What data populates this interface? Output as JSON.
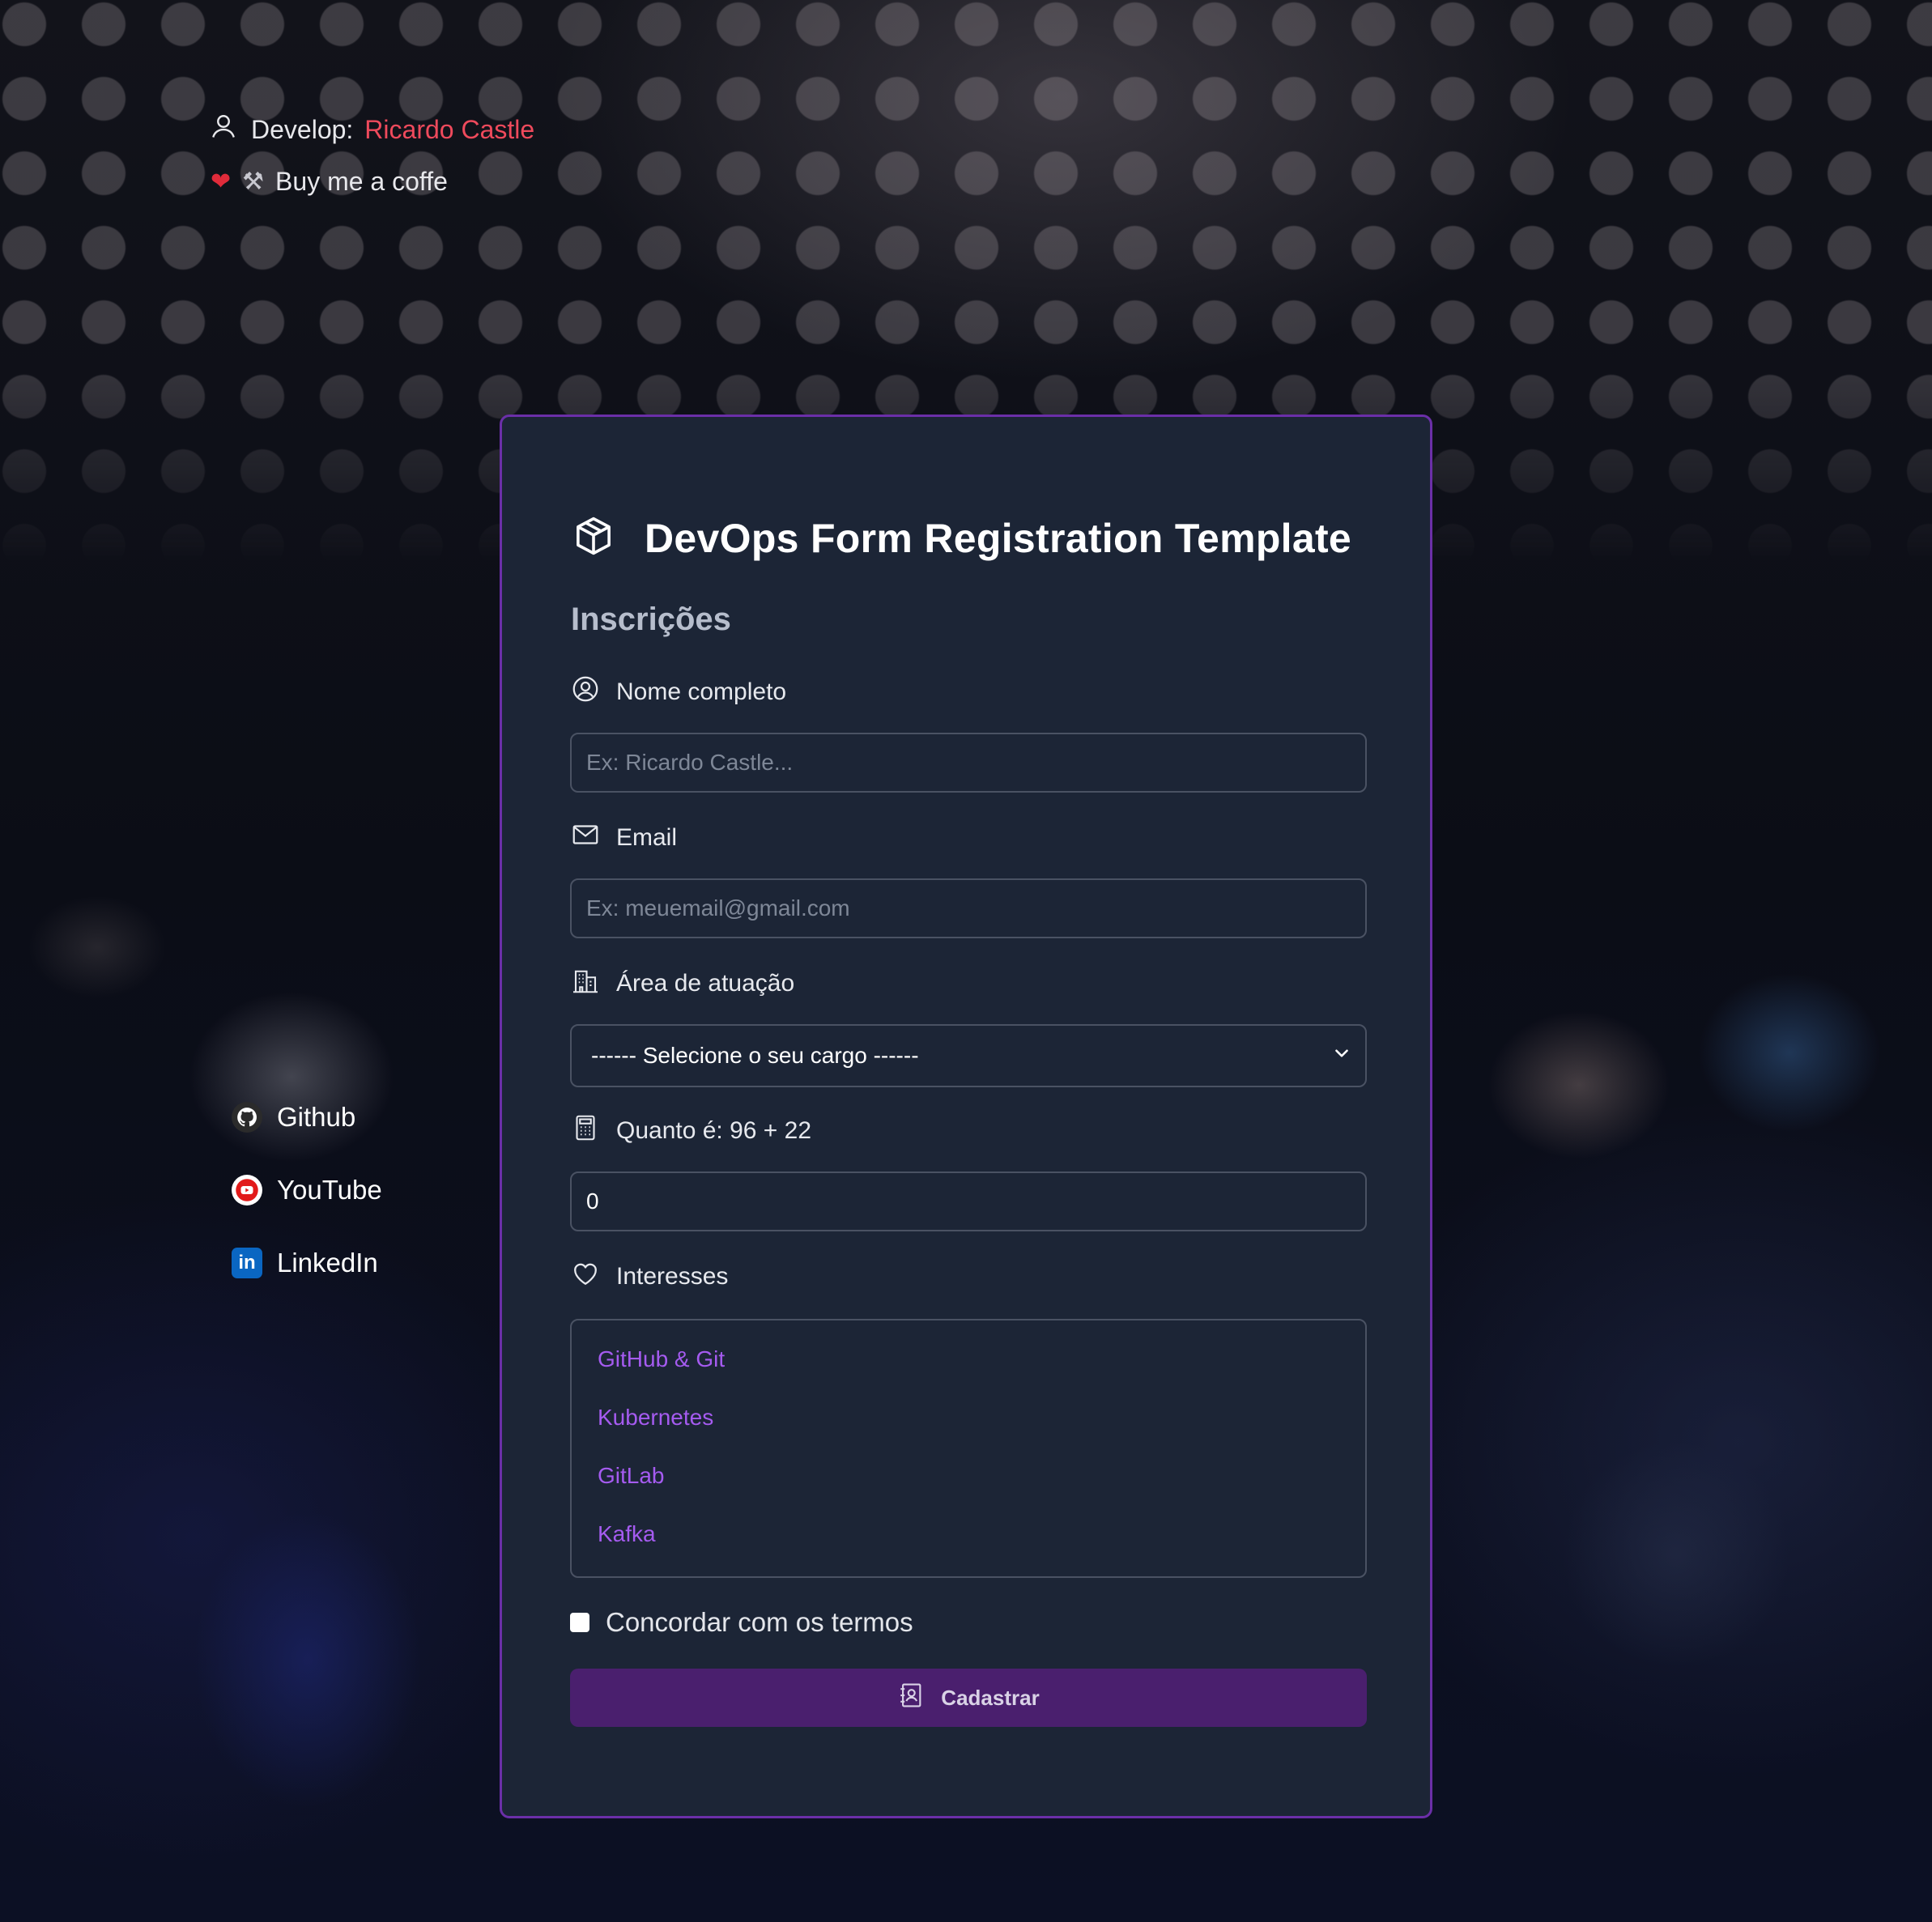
{
  "developer": {
    "label": "Develop:",
    "name": "Ricardo Castle",
    "coffee_text": "Buy me a coffe",
    "icons": [
      "user-icon",
      "heart-icon",
      "tools-icon"
    ]
  },
  "social_links": [
    {
      "label": "Github",
      "icon": "github-icon"
    },
    {
      "label": "YouTube",
      "icon": "youtube-icon"
    },
    {
      "label": "LinkedIn",
      "icon": "linkedin-icon"
    }
  ],
  "form": {
    "title": "DevOps Form Registration Template",
    "subtitle": "Inscrições",
    "name_field": {
      "label": "Nome completo",
      "placeholder": "Ex: Ricardo Castle...",
      "value": ""
    },
    "email_field": {
      "label": "Email",
      "placeholder": "Ex: meuemail@gmail.com",
      "value": ""
    },
    "area_field": {
      "label": "Área de atuação",
      "selected": "------ Selecione o seu cargo ------"
    },
    "captcha_field": {
      "label": "Quanto é: 96 + 22",
      "value": "0"
    },
    "interests": {
      "label": "Interesses",
      "items": [
        "GitHub & Git",
        "Kubernetes",
        "GitLab",
        "Kafka"
      ]
    },
    "terms_label": "Concordar com os termos",
    "submit_label": "Cadastrar"
  },
  "colors": {
    "card_bg": "#1c2536",
    "card_border": "#6b2fa8",
    "accent_purple": "#a55bf0",
    "button_bg": "#4a1f6e",
    "developer_name": "#ef4a5c"
  }
}
